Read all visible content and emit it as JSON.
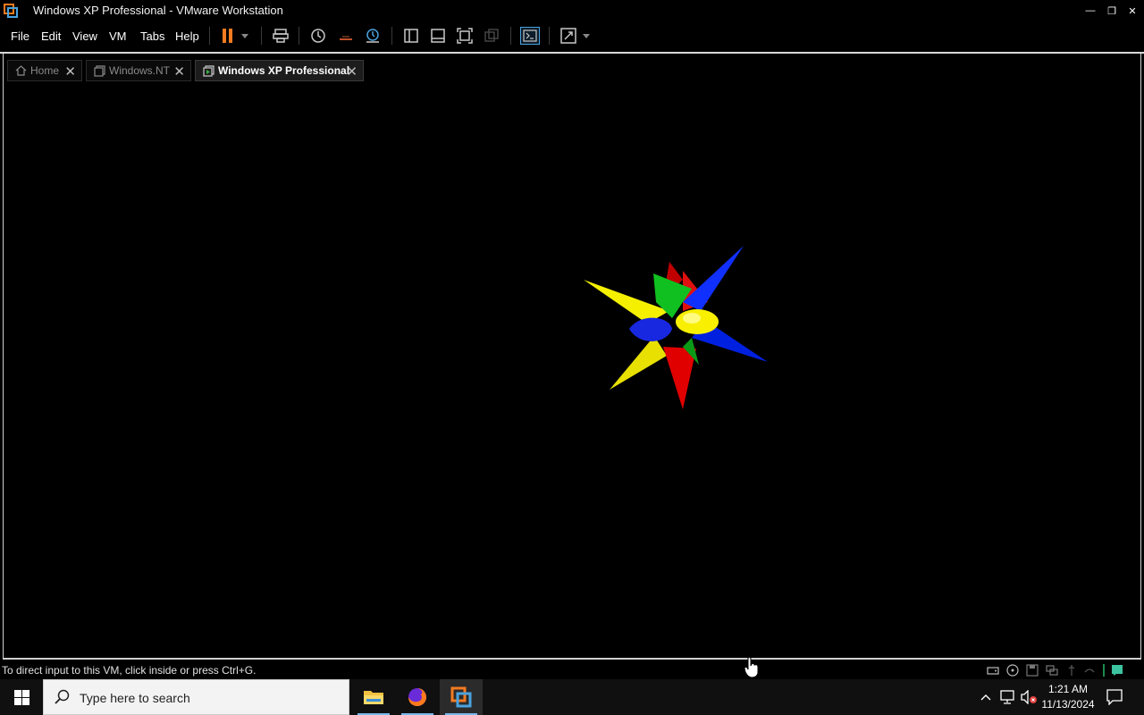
{
  "window": {
    "title": "Windows XP Professional - VMware Workstation",
    "minimize": "—",
    "restore": "❐",
    "close": "✕"
  },
  "menu": {
    "file": "File",
    "edit": "Edit",
    "view": "View",
    "vm": "VM",
    "tabs": "Tabs",
    "help": "Help"
  },
  "tabs": [
    {
      "label": "Home",
      "icon": "home-icon"
    },
    {
      "label": "Windows.NT",
      "icon": "vm-icon"
    },
    {
      "label": "Windows XP Professional",
      "icon": "vm-running-icon",
      "active": true
    }
  ],
  "status": {
    "message": "To direct input to this VM, click inside or press Ctrl+G."
  },
  "taskbar": {
    "search_placeholder": "Type here to search",
    "time": "1:21 AM",
    "date": "11/13/2024",
    "tray_chevron": "^"
  },
  "colors": {
    "accent": "#f47b20",
    "toolbar_icon": "#c8c8c8",
    "taskbar_underline": "#76b9ed"
  }
}
